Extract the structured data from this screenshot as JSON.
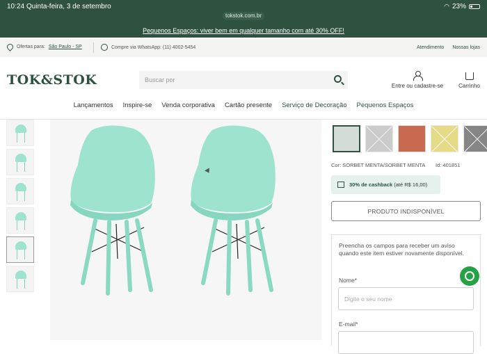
{
  "statusbar": {
    "time": "10:24",
    "date": "Quinta-feira, 3 de setembro",
    "url": "tokstok.com.br",
    "battery": "23%"
  },
  "promo": {
    "text": "Pequenos Espaços: viver bem em qualquer tamanho com até 30% OFF!"
  },
  "topbar": {
    "location_label": "Ofertas para:",
    "location_value": "São Paulo - SP",
    "whatsapp": "Compre via WhatsApp: (11) 4002-5454",
    "atendimento": "Atendimento",
    "nossas_lojas": "Nossas lojas"
  },
  "header": {
    "logo": "TOK&STOK",
    "search_placeholder": "Buscar por",
    "account": "Entre ou cadastre-se",
    "cart": "Carrinho"
  },
  "nav": {
    "items": [
      "Lançamentos",
      "Inspire-se",
      "Venda corporativa",
      "Cartão presente",
      "Serviço de Decoração",
      "Pequenos Espaços"
    ]
  },
  "product": {
    "color_label": "Cor: SORBET MENTA/SORBET MENTA",
    "id_label": "Id: 401851",
    "cashback_bold": "30% de cashback",
    "cashback_rest": "(até R$ 16,00)",
    "unavailable": "PRODUTO INDISPONÍVEL",
    "swatch_colors": [
      "#a8d8c8",
      "#b0b0b0",
      "#c86a50",
      "#d8c848",
      "#444444"
    ]
  },
  "notify": {
    "text": "Preencha os campos para receber um aviso quando este item estiver novamente disponível.",
    "name_label": "Nome*",
    "name_placeholder": "Digite o seu nome",
    "email_label": "E-mail*"
  },
  "colors": {
    "brand": "#2f5240",
    "chair": "#9ee3cf",
    "whatsapp": "#25a244"
  }
}
